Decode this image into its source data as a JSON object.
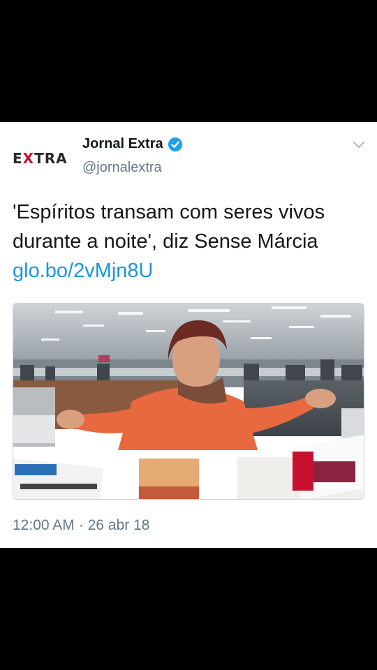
{
  "tweet": {
    "avatar_text_pre": "E",
    "avatar_text_accent": "X",
    "avatar_text_post": "TRA",
    "display_name": "Jornal Extra",
    "handle": "@jornalextra",
    "text": "'Espíritos transam com seres vivos durante a noite', diz Sense Márcia",
    "link": "glo.bo/2vMjn8U",
    "time": "12:00 AM",
    "separator": "·",
    "date": "26 abr 18"
  },
  "icons": {
    "verified": "verified-badge-icon",
    "menu": "chevron-down-icon"
  },
  "colors": {
    "link": "#1b95e0",
    "verified": "#1da1f2",
    "secondary_text": "#657786",
    "primary_text": "#14171a",
    "brand_red": "#c8102e"
  }
}
